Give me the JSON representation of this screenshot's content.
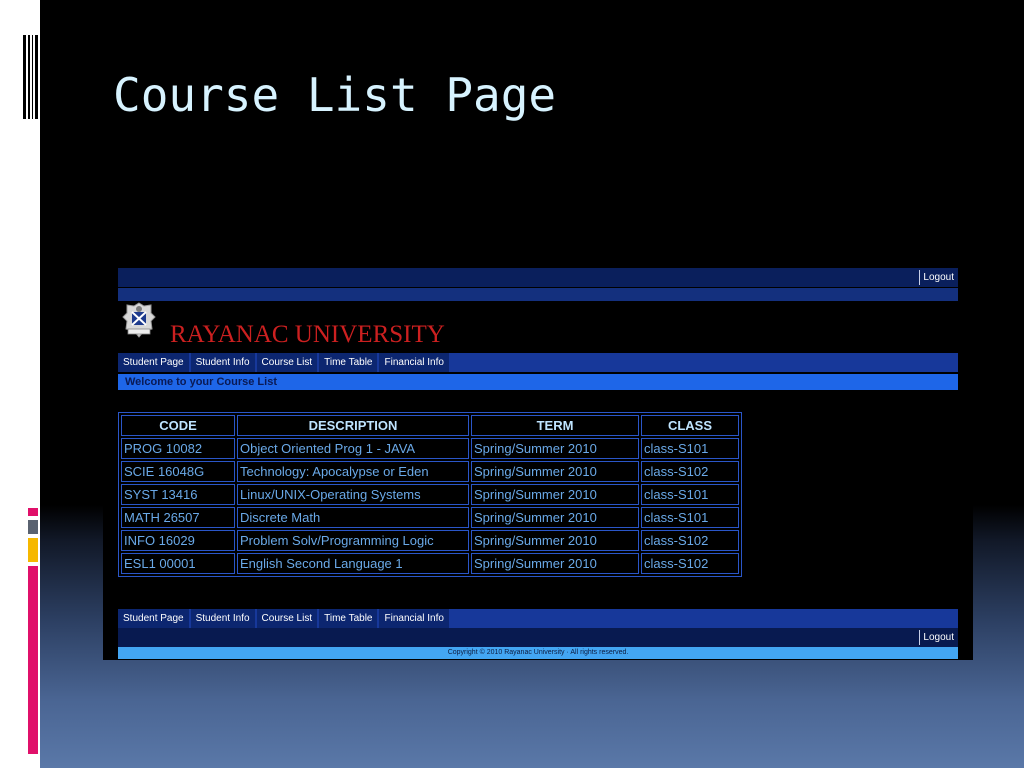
{
  "slide": {
    "title": "Course List Page"
  },
  "webpage": {
    "logout_label": "Logout",
    "university_name": "RAYANAC UNIVERSITY",
    "nav": [
      "Student Page",
      "Student Info",
      "Course List",
      "Time Table",
      "Financial Info"
    ],
    "welcome_text": "Welcome to your Course List",
    "table": {
      "headers": [
        "CODE",
        "DESCRIPTION",
        "TERM",
        "CLASS"
      ],
      "rows": [
        [
          "PROG 10082",
          "Object Oriented Prog 1 - JAVA",
          "Spring/Summer 2010",
          "class-S101"
        ],
        [
          "SCIE 16048G",
          "Technology: Apocalypse or Eden",
          "Spring/Summer 2010",
          "class-S102"
        ],
        [
          "SYST 13416",
          "Linux/UNIX-Operating Systems",
          "Spring/Summer 2010",
          "class-S101"
        ],
        [
          "MATH 26507",
          "Discrete Math",
          "Spring/Summer 2010",
          "class-S101"
        ],
        [
          "INFO 16029",
          "Problem Solv/Programming Logic",
          "Spring/Summer 2010",
          "class-S102"
        ],
        [
          "ESL1 00001",
          "English Second Language 1",
          "Spring/Summer 2010",
          "class-S102"
        ]
      ]
    },
    "copyright": "Copyright © 2010 Rayanac University · All rights reserved."
  },
  "colors": {
    "title": "#d7f3ff",
    "university_name": "#cc2020",
    "nav_bar": "#17389a",
    "welcome_bar": "#1e66e8",
    "table_border": "#2a56c8",
    "copyright_bar": "#43a6f3",
    "accent_pink": "#e0106a",
    "accent_yellow": "#f6b800"
  }
}
